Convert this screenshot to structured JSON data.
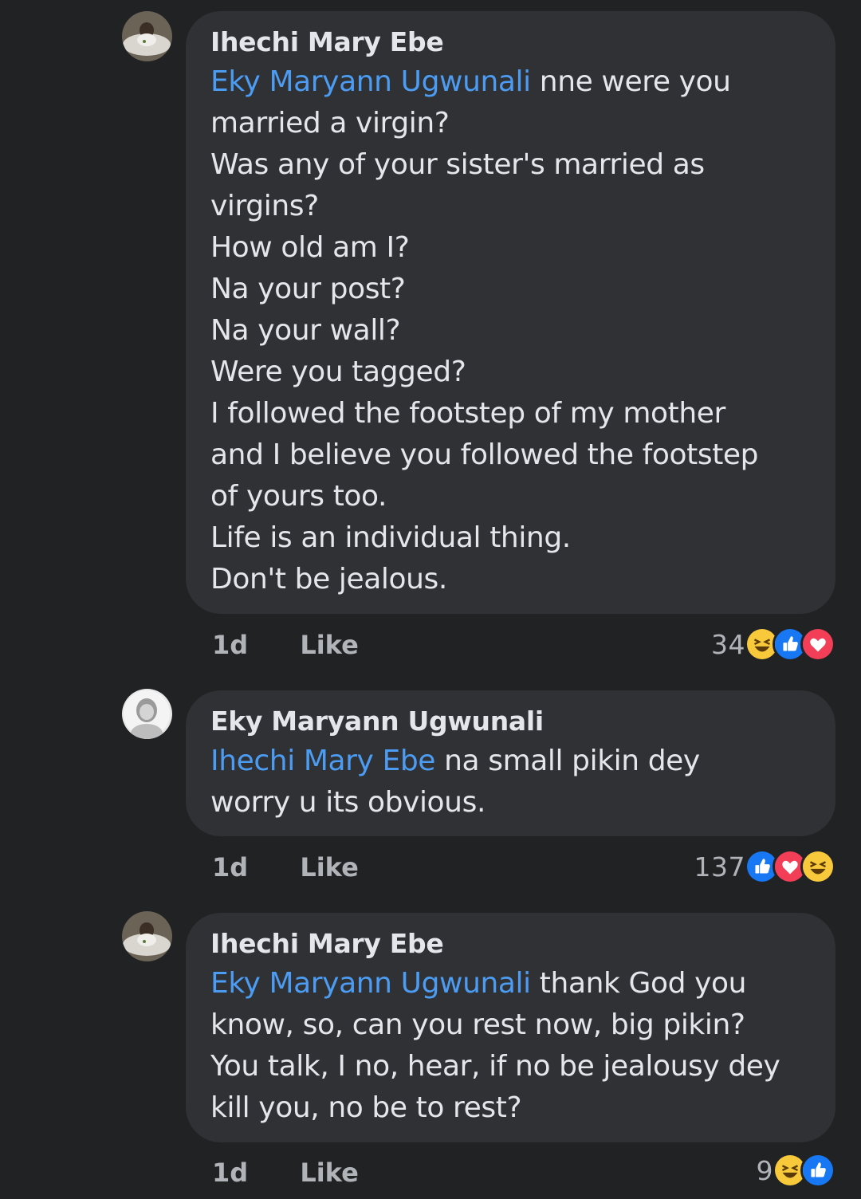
{
  "comments": [
    {
      "author": "Ihechi Mary Ebe",
      "lines": [
        [
          {
            "mention": "Eky Maryann Ugwunali"
          },
          {
            "text": " nne were you"
          }
        ],
        [
          {
            "text": "married a virgin?"
          }
        ],
        [
          {
            "text": "Was any of your sister's married as"
          }
        ],
        [
          {
            "text": "virgins?"
          }
        ],
        [
          {
            "text": "How old am I?"
          }
        ],
        [
          {
            "text": "Na your post?"
          }
        ],
        [
          {
            "text": "Na your wall?"
          }
        ],
        [
          {
            "text": "Were you tagged?"
          }
        ],
        [
          {
            "text": "I followed the footstep of my mother"
          }
        ],
        [
          {
            "text": "and I believe you followed the footstep"
          }
        ],
        [
          {
            "text": "of yours too."
          }
        ],
        [
          {
            "text": "Life is an individual thing."
          }
        ],
        [
          {
            "text": "Don't be jealous."
          }
        ]
      ],
      "time": "1d",
      "like_label": "Like",
      "reaction_count": "34",
      "reactions": [
        "haha-icon",
        "like-icon",
        "love-icon"
      ]
    },
    {
      "author": "Eky Maryann Ugwunali",
      "lines": [
        [
          {
            "mention": "Ihechi Mary Ebe"
          },
          {
            "text": " na small pikin dey"
          }
        ],
        [
          {
            "text": "worry u its obvious."
          }
        ]
      ],
      "time": "1d",
      "like_label": "Like",
      "reaction_count": "137",
      "reactions": [
        "like-icon",
        "love-icon",
        "haha-icon"
      ]
    },
    {
      "author": "Ihechi Mary Ebe",
      "lines": [
        [
          {
            "mention": "Eky Maryann Ugwunali"
          },
          {
            "text": " thank God you"
          }
        ],
        [
          {
            "text": "know, so, can you rest now, big pikin?"
          }
        ],
        [
          {
            "text": "You talk, I no, hear, if no be jealousy dey"
          }
        ],
        [
          {
            "text": "kill you, no be to rest?"
          }
        ]
      ],
      "time": "1d",
      "like_label": "Like",
      "reaction_count": "9",
      "reactions": [
        "haha-icon",
        "like-icon"
      ]
    }
  ],
  "colors": {
    "background": "#212224",
    "bubble": "#303134",
    "mention": "#4b9cf2",
    "text": "#e4e6eb",
    "meta": "#b0b3b8",
    "like_reaction": "#1877f2",
    "love_reaction": "#f33e58",
    "haha_reaction": "#f7c93b"
  }
}
